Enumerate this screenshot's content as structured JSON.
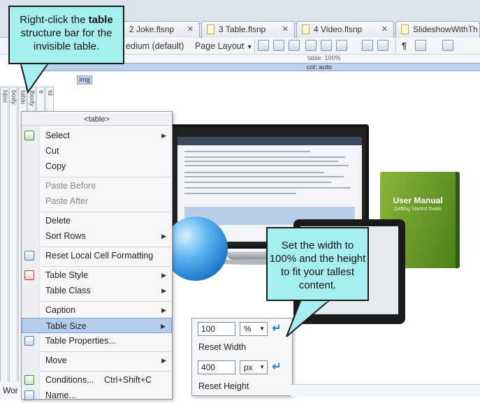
{
  "tabs": [
    {
      "label": "2 Joke.flsnp"
    },
    {
      "label": "3 Table.flsnp"
    },
    {
      "label": "4 Video.flsnp"
    },
    {
      "label": "SlideshowWithTh"
    }
  ],
  "toolbar": {
    "style_value": "edium (default)",
    "layout_label": "Page Layout"
  },
  "ruler": {
    "table_label": "table: 100%",
    "col_label": "col: auto"
  },
  "structure_bars": [
    "html",
    "body",
    "table",
    "tbody",
    "tr",
    "td"
  ],
  "img_tag": "img",
  "hero": {
    "book_title": "User Manual",
    "book_subtitle": "Getting Started Guide"
  },
  "context_menu": {
    "header": "<table>",
    "items": [
      {
        "label": "Select",
        "submenu": true
      },
      {
        "label": "Cut"
      },
      {
        "label": "Copy"
      },
      {
        "label": "Paste Before",
        "disabled": true
      },
      {
        "label": "Paste After",
        "disabled": true
      },
      {
        "label": "Delete"
      },
      {
        "label": "Sort Rows",
        "submenu": true
      },
      {
        "label": "Reset Local Cell Formatting"
      },
      {
        "label": "Table Style",
        "submenu": true
      },
      {
        "label": "Table Class",
        "submenu": true
      },
      {
        "label": "Caption",
        "submenu": true
      },
      {
        "label": "Table Size",
        "submenu": true,
        "highlighted": true
      },
      {
        "label": "Table Properties..."
      },
      {
        "label": "Move",
        "submenu": true
      },
      {
        "label": "Conditions...",
        "shortcut": "Ctrl+Shift+C"
      },
      {
        "label": "Name..."
      }
    ],
    "submenu_arrow": "▶"
  },
  "table_size": {
    "width_value": "100",
    "width_unit": "%",
    "reset_width": "Reset Width",
    "height_value": "400",
    "height_unit": "px",
    "reset_height": "Reset Height"
  },
  "callouts": {
    "right_click_pre": "Right-click the ",
    "right_click_bold": "table",
    "right_click_post": "structure bar for the invisible table.",
    "set_width": "Set the width to 100% and the height to fit your tallest content."
  },
  "status": {
    "bottom_left": "Wor"
  }
}
